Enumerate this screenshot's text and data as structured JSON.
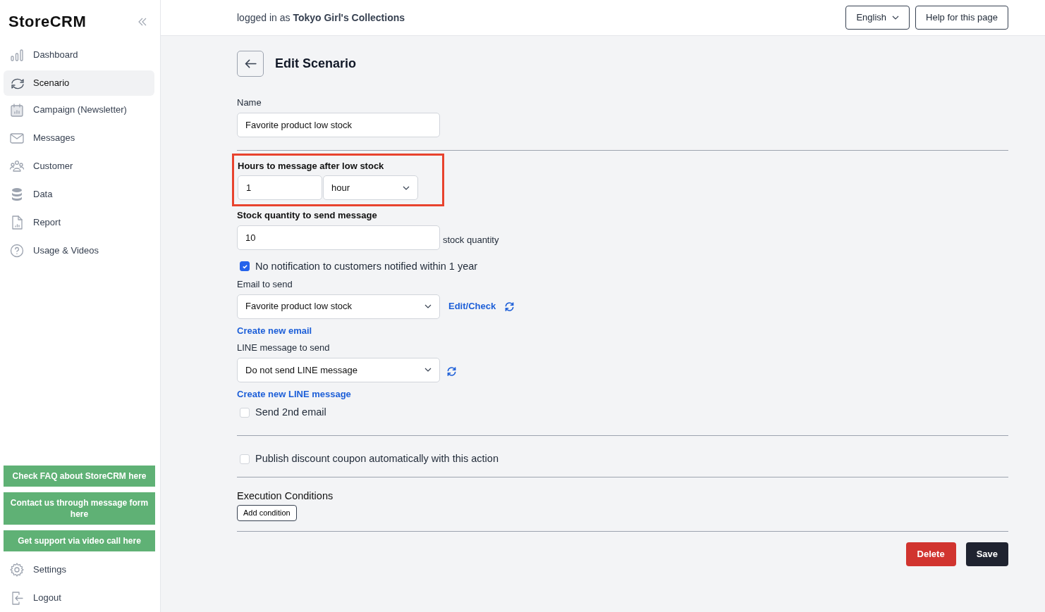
{
  "sidebar": {
    "logo": "StoreCRM",
    "items": [
      {
        "label": "Dashboard",
        "selected": false
      },
      {
        "label": "Scenario",
        "selected": true
      },
      {
        "label": "Campaign (Newsletter)",
        "selected": false
      },
      {
        "label": "Messages",
        "selected": false
      },
      {
        "label": "Customer",
        "selected": false
      },
      {
        "label": "Data",
        "selected": false
      },
      {
        "label": "Report",
        "selected": false
      },
      {
        "label": "Usage & Videos",
        "selected": false
      }
    ],
    "help_buttons": [
      "Check FAQ about StoreCRM here",
      "Contact us through message form here",
      "Get support via video call here"
    ],
    "bottom_items": [
      {
        "label": "Settings",
        "selected": false
      },
      {
        "label": "Logout",
        "selected": false
      }
    ]
  },
  "header": {
    "login_text": "logged in as **Tokyo Girl's Collections**",
    "language": "English",
    "help": "Help for this page"
  },
  "form": {
    "title": "Edit Scenario",
    "name": {
      "label": "Name",
      "value": "Favorite product low stock"
    },
    "hours": {
      "label": "Hours to message after low stock",
      "value": "1",
      "unit": "hour",
      "highlighted": true
    },
    "stock": {
      "label": "Stock quantity to send message",
      "value": "10",
      "suffix": "stock quantity"
    },
    "no_notify": {
      "label": "No notification to customers notified within 1 year",
      "checked": true
    },
    "email": {
      "label": "Email to send",
      "value": "Favorite product low stock",
      "link": "Edit/Check",
      "create": "Create new email"
    },
    "line": {
      "label": "LINE message to send",
      "value": "Do not send LINE message",
      "create": "Create new LINE message"
    },
    "send_2nd": {
      "label": "Send 2nd email",
      "checked": false
    },
    "coupon": {
      "label": "Publish discount coupon automatically with this action",
      "checked": false
    },
    "conditions": {
      "title": "Execution Conditions",
      "button": "Add condition"
    },
    "delete": "Delete",
    "save": "Save"
  }
}
